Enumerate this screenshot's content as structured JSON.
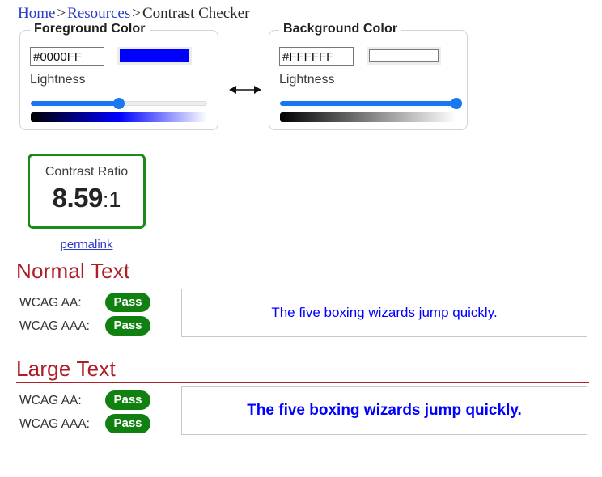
{
  "breadcrumb": {
    "home": "Home",
    "sep1": ">",
    "resources": "Resources",
    "sep2": ">",
    "current": "Contrast Checker"
  },
  "foreground": {
    "legend": "Foreground Color",
    "hex_value": "#0000FF",
    "hex_placeholder": "#000000",
    "swatch_color": "#0000FF",
    "lightness_label": "Lightness",
    "lightness_percent": 50,
    "gradient": "linear-gradient(to right, #000000 0%, #0000FF 50%, #FFFFFF 100%)"
  },
  "background": {
    "legend": "Background Color",
    "hex_value": "#FFFFFF",
    "hex_placeholder": "#FFFFFF",
    "swatch_color": "#FFFFFF",
    "lightness_label": "Lightness",
    "lightness_percent": 100,
    "gradient": "linear-gradient(to right, #000000 0%, #808080 50%, #FFFFFF 100%)"
  },
  "swap": {
    "label": "↔"
  },
  "result": {
    "title": "Contrast Ratio",
    "value": "8.59",
    "suffix": ":1",
    "border_color": "#1a8a1a",
    "permalink_label": "permalink"
  },
  "sections": [
    {
      "heading": "Normal Text",
      "criteria": [
        {
          "label": "WCAG AA:",
          "badge": "Pass"
        },
        {
          "label": "WCAG AAA:",
          "badge": "Pass"
        }
      ],
      "sample_text": "The five boxing wizards jump quickly."
    },
    {
      "heading": "Large Text",
      "criteria": [
        {
          "label": "WCAG AA:",
          "badge": "Pass"
        },
        {
          "label": "WCAG AAA:",
          "badge": "Pass"
        }
      ],
      "sample_text": "The five boxing wizards jump quickly."
    }
  ],
  "colors": {
    "pass_green": "#108010",
    "heading_red": "#ad1e28",
    "link_blue": "#2d3cc8",
    "sample_blue": "#1f14f0",
    "slider_blue": "#1878f0"
  }
}
